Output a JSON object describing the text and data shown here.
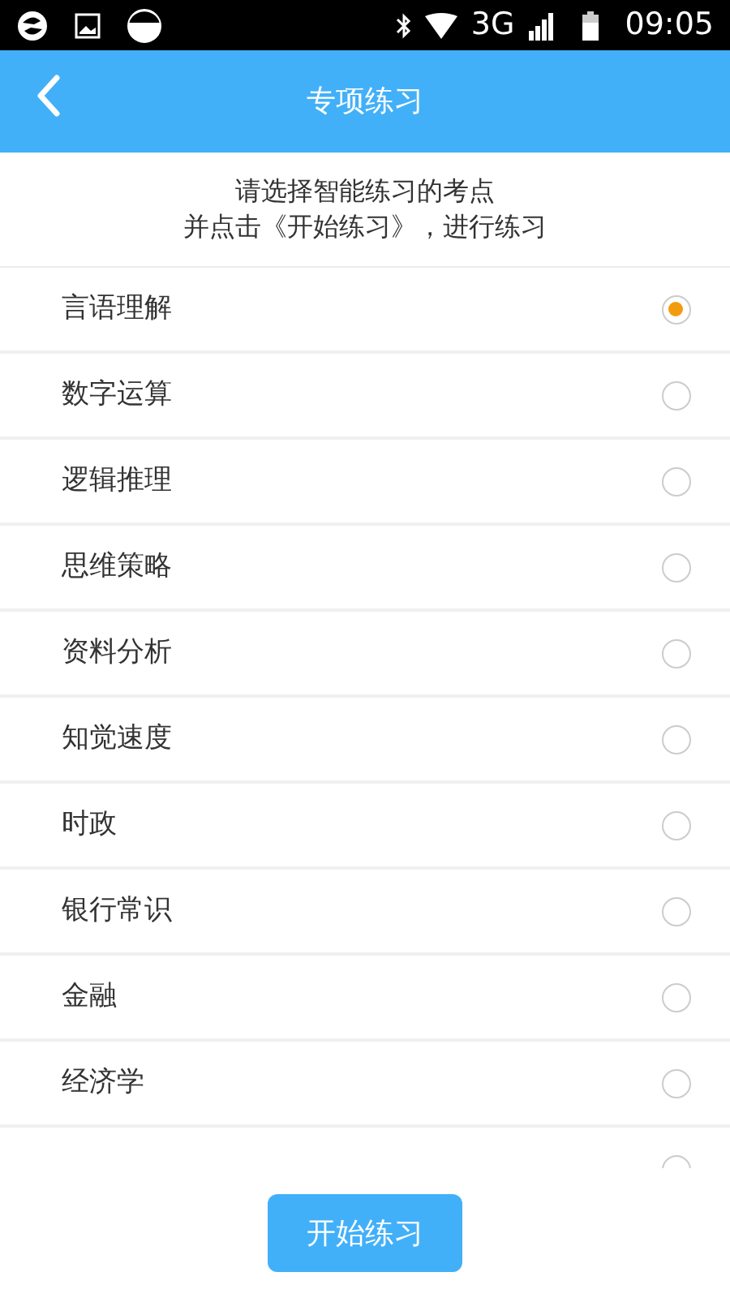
{
  "status_bar": {
    "network": "3G",
    "time": "09:05"
  },
  "header": {
    "title": "专项练习"
  },
  "instruction": [
    "请选择智能练习的考点",
    "并点击《开始练习》，进行练习"
  ],
  "options": [
    {
      "label": "言语理解",
      "selected": true
    },
    {
      "label": "数字运算",
      "selected": false
    },
    {
      "label": "逻辑推理",
      "selected": false
    },
    {
      "label": "思维策略",
      "selected": false
    },
    {
      "label": "资料分析",
      "selected": false
    },
    {
      "label": "知觉速度",
      "selected": false
    },
    {
      "label": "时政",
      "selected": false
    },
    {
      "label": "银行常识",
      "selected": false
    },
    {
      "label": "金融",
      "selected": false
    },
    {
      "label": "经济学",
      "selected": false
    },
    {
      "selected": false
    }
  ],
  "start_button": "开始练习"
}
